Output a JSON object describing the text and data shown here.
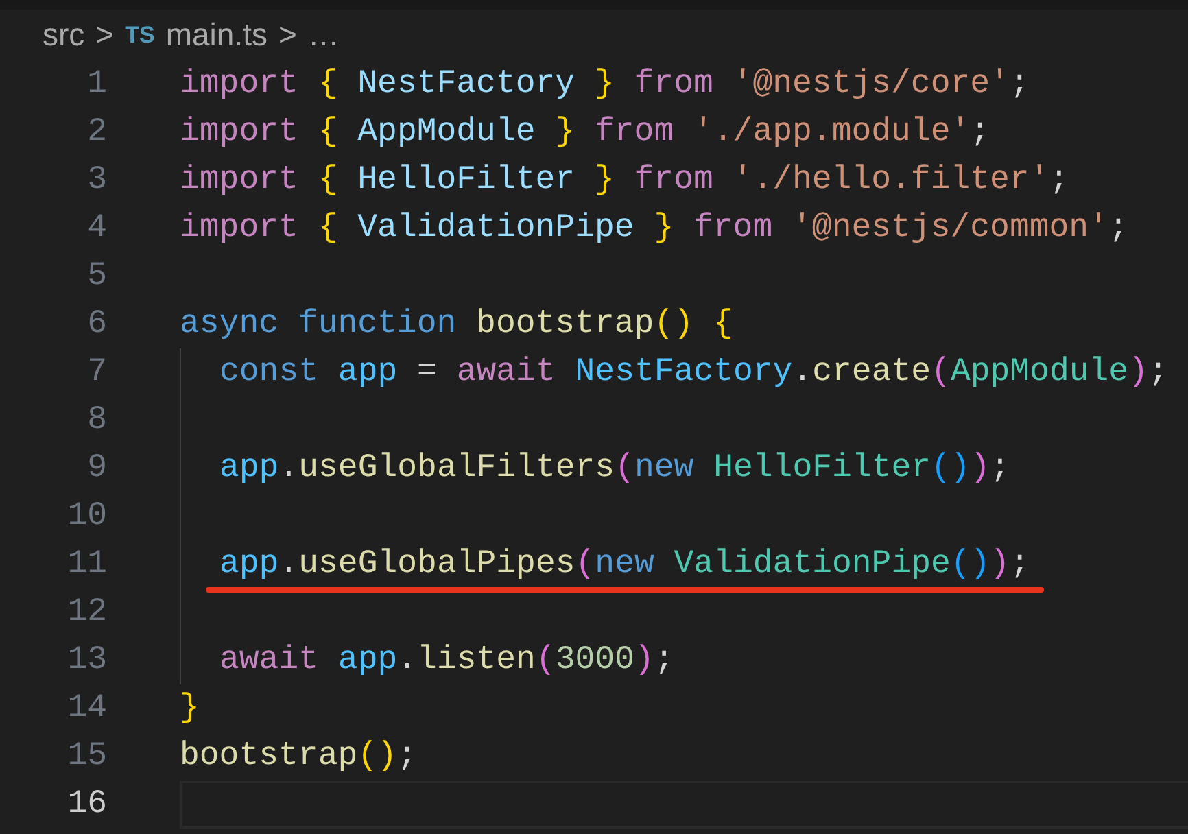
{
  "breadcrumb": {
    "folder": "src",
    "file_icon": "TS",
    "file": "main.ts",
    "more": "…",
    "separators": [
      ">",
      ">"
    ]
  },
  "lines": [
    {
      "number": "1",
      "tokens": [
        {
          "kind": "import",
          "t": "import "
        },
        {
          "kind": "brace",
          "t": "{ "
        },
        {
          "kind": "ident",
          "t": "NestFactory "
        },
        {
          "kind": "brace",
          "t": "} "
        },
        {
          "kind": "import",
          "t": "from "
        },
        {
          "kind": "string",
          "t": "'@nestjs/core'"
        },
        {
          "kind": "plain",
          "t": ";"
        }
      ]
    },
    {
      "number": "2",
      "tokens": [
        {
          "kind": "import",
          "t": "import "
        },
        {
          "kind": "brace",
          "t": "{ "
        },
        {
          "kind": "ident",
          "t": "AppModule "
        },
        {
          "kind": "brace",
          "t": "} "
        },
        {
          "kind": "import",
          "t": "from "
        },
        {
          "kind": "string",
          "t": "'./app.module'"
        },
        {
          "kind": "plain",
          "t": ";"
        }
      ]
    },
    {
      "number": "3",
      "tokens": [
        {
          "kind": "import",
          "t": "import "
        },
        {
          "kind": "brace",
          "t": "{ "
        },
        {
          "kind": "ident",
          "t": "HelloFilter "
        },
        {
          "kind": "brace",
          "t": "} "
        },
        {
          "kind": "import",
          "t": "from "
        },
        {
          "kind": "string",
          "t": "'./hello.filter'"
        },
        {
          "kind": "plain",
          "t": ";"
        }
      ]
    },
    {
      "number": "4",
      "tokens": [
        {
          "kind": "import",
          "t": "import "
        },
        {
          "kind": "brace",
          "t": "{ "
        },
        {
          "kind": "ident",
          "t": "ValidationPipe "
        },
        {
          "kind": "brace",
          "t": "} "
        },
        {
          "kind": "import",
          "t": "from "
        },
        {
          "kind": "string",
          "t": "'@nestjs/common'"
        },
        {
          "kind": "plain",
          "t": ";"
        }
      ]
    },
    {
      "number": "5"
    },
    {
      "number": "6",
      "tokens": [
        {
          "kind": "storage",
          "t": "async function "
        },
        {
          "kind": "func",
          "t": "bootstrap"
        },
        {
          "kind": "brace",
          "t": "() {"
        }
      ]
    },
    {
      "number": "7",
      "indent_guide": true,
      "tokens": [
        {
          "kind": "storage",
          "t": "const "
        },
        {
          "kind": "const",
          "t": "app "
        },
        {
          "kind": "plain",
          "t": "= "
        },
        {
          "kind": "import",
          "t": "await "
        },
        {
          "kind": "const",
          "t": "NestFactory"
        },
        {
          "kind": "plain",
          "t": "."
        },
        {
          "kind": "func",
          "t": "create"
        },
        {
          "kind": "paren",
          "t": "("
        },
        {
          "kind": "class",
          "t": "AppModule"
        },
        {
          "kind": "paren",
          "t": ")"
        },
        {
          "kind": "plain",
          "t": ";"
        }
      ]
    },
    {
      "number": "8",
      "indent_guide": true
    },
    {
      "number": "9",
      "indent_guide": true,
      "tokens": [
        {
          "kind": "const",
          "t": "app"
        },
        {
          "kind": "plain",
          "t": "."
        },
        {
          "kind": "func",
          "t": "useGlobalFilters"
        },
        {
          "kind": "paren",
          "t": "("
        },
        {
          "kind": "storage",
          "t": "new "
        },
        {
          "kind": "class",
          "t": "HelloFilter"
        },
        {
          "kind": "paren2",
          "t": "()"
        },
        {
          "kind": "paren",
          "t": ")"
        },
        {
          "kind": "plain",
          "t": ";"
        }
      ]
    },
    {
      "number": "10",
      "indent_guide": true
    },
    {
      "number": "11",
      "indent_guide": true,
      "underlined": true,
      "tokens": [
        {
          "kind": "const",
          "t": "app"
        },
        {
          "kind": "plain",
          "t": "."
        },
        {
          "kind": "func",
          "t": "useGlobalPipes"
        },
        {
          "kind": "paren",
          "t": "("
        },
        {
          "kind": "storage",
          "t": "new "
        },
        {
          "kind": "class",
          "t": "ValidationPipe"
        },
        {
          "kind": "paren2",
          "t": "()"
        },
        {
          "kind": "paren",
          "t": ")"
        },
        {
          "kind": "plain",
          "t": ";"
        }
      ]
    },
    {
      "number": "12",
      "indent_guide": true
    },
    {
      "number": "13",
      "indent_guide": true,
      "tokens": [
        {
          "kind": "import",
          "t": "await "
        },
        {
          "kind": "const",
          "t": "app"
        },
        {
          "kind": "plain",
          "t": "."
        },
        {
          "kind": "func",
          "t": "listen"
        },
        {
          "kind": "paren",
          "t": "("
        },
        {
          "kind": "number",
          "t": "3000"
        },
        {
          "kind": "paren",
          "t": ")"
        },
        {
          "kind": "plain",
          "t": ";"
        }
      ]
    },
    {
      "number": "14",
      "tokens": [
        {
          "kind": "brace",
          "t": "}"
        }
      ]
    },
    {
      "number": "15",
      "tokens": [
        {
          "kind": "func",
          "t": "bootstrap"
        },
        {
          "kind": "brace",
          "t": "()"
        },
        {
          "kind": "plain",
          "t": ";"
        }
      ]
    },
    {
      "number": "16",
      "current": true
    }
  ]
}
